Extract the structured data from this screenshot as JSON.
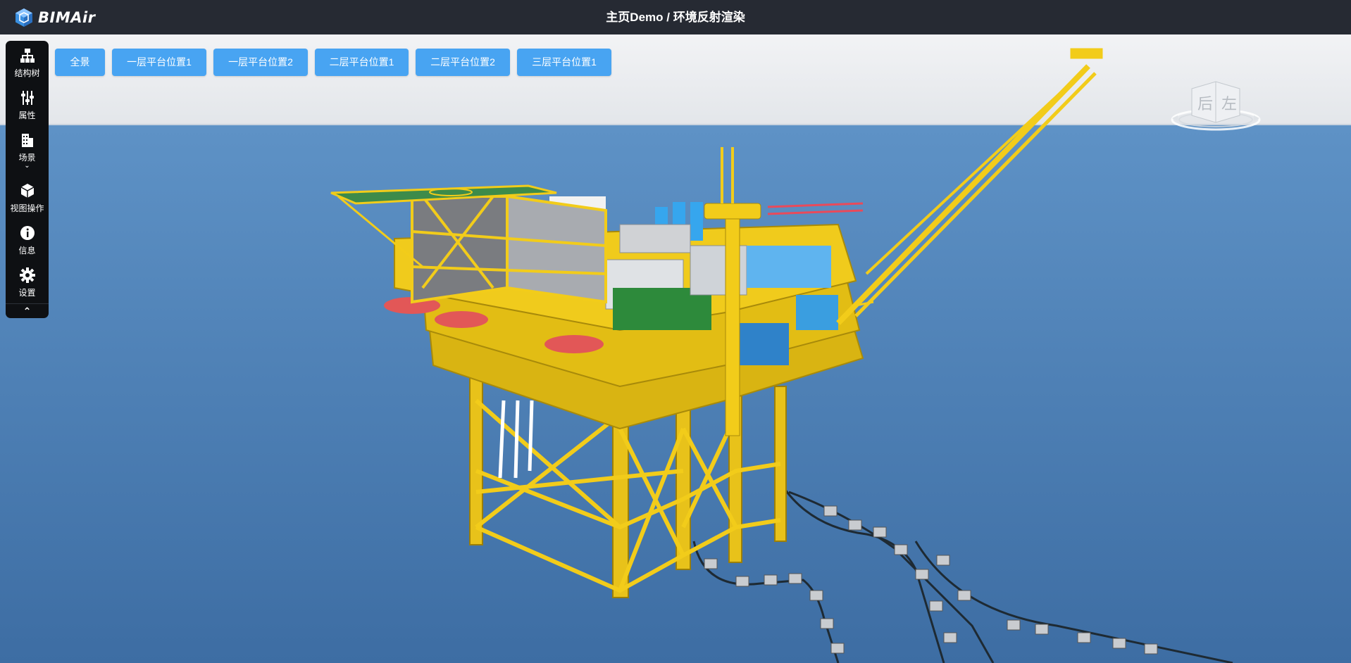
{
  "app": {
    "logo_text": "BIMAir",
    "title": "主页Demo / 环境反射渲染"
  },
  "toolbar": {
    "items": [
      {
        "label": "结构树",
        "icon": "sitemap-icon"
      },
      {
        "label": "属性",
        "icon": "sliders-icon"
      },
      {
        "label": "场景",
        "icon": "building-icon"
      },
      {
        "label": "视图操作",
        "icon": "cube-icon"
      },
      {
        "label": "信息",
        "icon": "info-icon"
      },
      {
        "label": "设置",
        "icon": "gear-icon"
      }
    ],
    "scene_chevron": "⌄",
    "collapse_glyph": "⌃"
  },
  "camera_buttons": [
    {
      "label": "全景"
    },
    {
      "label": "一层平台位置1"
    },
    {
      "label": "一层平台位置2"
    },
    {
      "label": "二层平台位置1"
    },
    {
      "label": "二层平台位置2"
    },
    {
      "label": "三层平台位置1"
    }
  ],
  "view_cube": {
    "faces": [
      "后",
      "左"
    ]
  },
  "colors": {
    "topbar": "#262a33",
    "toolbar": "#0e1013",
    "button": "#48a4f2",
    "sea_top": "#5b8fc3",
    "sea_bottom": "#3f6ea3",
    "sky": "#eef0f3",
    "structure": "#f2cc1a"
  }
}
